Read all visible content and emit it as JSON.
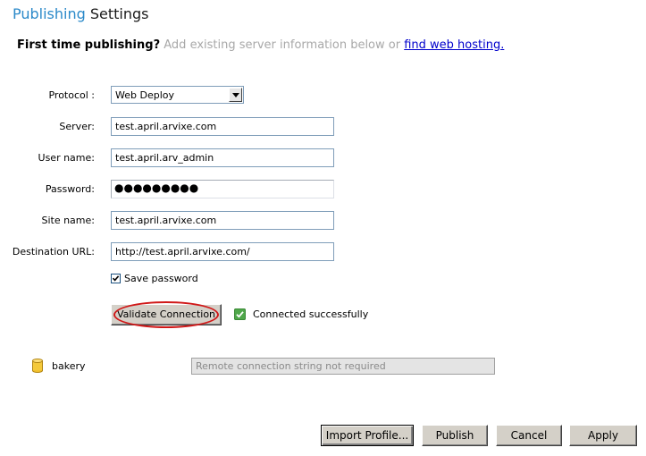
{
  "header": {
    "title_part1": "Publishing",
    "title_part2": "Settings"
  },
  "intro": {
    "bold": "First time publishing?",
    "hint": "Add existing server information below or",
    "link": "find web hosting."
  },
  "form": {
    "protocol_label": "Protocol :",
    "protocol_value": "Web Deploy",
    "server_label": "Server:",
    "server_value": "test.april.arvixe.com",
    "username_label": "User name:",
    "username_value": "test.april.arv_admin",
    "password_label": "Password:",
    "password_masked": "●●●●●●●●●",
    "sitename_label": "Site name:",
    "sitename_value": "test.april.arvixe.com",
    "desturl_label": "Destination URL:",
    "desturl_value": "http://test.april.arvixe.com/",
    "save_password_label": "Save password",
    "save_password_checked": true
  },
  "validation": {
    "button_label": "Validate Connection",
    "status_text": "Connected successfully",
    "status_icon": "check-icon",
    "status_color": "#4fa74a",
    "highlight_color": "#d01818"
  },
  "database": {
    "icon": "database-icon",
    "name": "bakery",
    "connection_placeholder": "Remote connection string not required"
  },
  "footer": {
    "import_label": "Import Profile...",
    "publish_label": "Publish",
    "cancel_label": "Cancel",
    "apply_label": "Apply"
  },
  "colors": {
    "title_accent": "#2a89c9",
    "link": "#0000cc",
    "hint_text": "#a8a8a8"
  }
}
